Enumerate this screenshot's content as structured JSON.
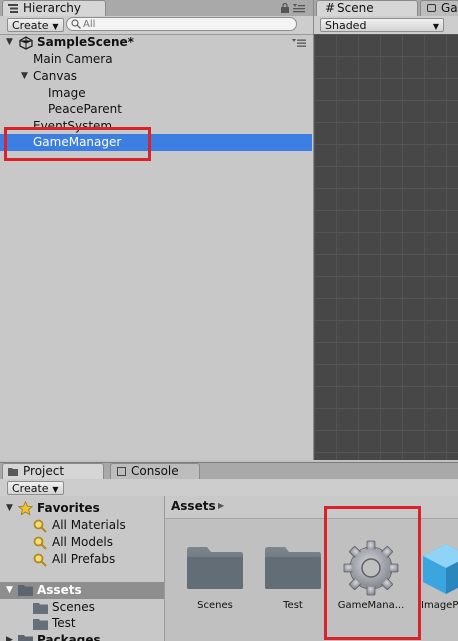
{
  "hierarchy": {
    "tab_label": "Hierarchy",
    "create_label": "Create",
    "search_placeholder": "All",
    "scene_name": "SampleScene*",
    "items": [
      {
        "label": "Main Camera"
      },
      {
        "label": "Canvas"
      },
      {
        "label": "Image"
      },
      {
        "label": "PeaceParent"
      },
      {
        "label": "EventSystem"
      },
      {
        "label": "GameManager",
        "selected": true
      }
    ]
  },
  "scene": {
    "tab_label": "Scene",
    "second_tab_label": "Ga",
    "shading_mode": "Shaded"
  },
  "project": {
    "tab_label": "Project",
    "console_tab_label": "Console",
    "create_label": "Create",
    "favorites_label": "Favorites",
    "favorites": [
      {
        "label": "All Materials"
      },
      {
        "label": "All Models"
      },
      {
        "label": "All Prefabs"
      }
    ],
    "assets_label": "Assets",
    "asset_folders": [
      {
        "label": "Scenes"
      },
      {
        "label": "Test"
      }
    ],
    "packages_label": "Packages",
    "breadcrumb_label": "Assets",
    "asset_items": [
      {
        "label": "Scenes",
        "icon": "folder-icon"
      },
      {
        "label": "Test",
        "icon": "folder-icon"
      },
      {
        "label": "GameMana...",
        "icon": "gear-icon"
      },
      {
        "label": "ImageP",
        "icon": "prefab-cube-icon"
      }
    ]
  },
  "colors": {
    "selection": "#3d7ee3",
    "highlight_box": "#d8232a",
    "scene_bg": "#474747"
  }
}
